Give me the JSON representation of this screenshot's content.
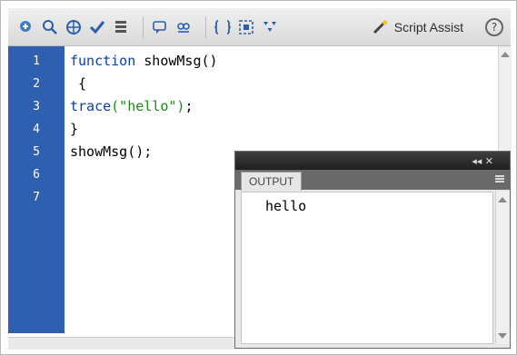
{
  "toolbar": {
    "icons": [
      "add-statement-icon",
      "find-icon",
      "target-path-icon",
      "check-syntax-icon",
      "auto-format-icon",
      "code-hint-icon",
      "debug-options-icon",
      "collapse-between-braces-icon",
      "collapse-selection-icon",
      "expand-all-icon"
    ],
    "script_assist_label": "Script Assist",
    "help_label": "?"
  },
  "editor": {
    "line_numbers": [
      "1",
      "2",
      "3",
      "4",
      "5",
      "6",
      "7"
    ],
    "lines": [
      {
        "kw": "function",
        "rest": " showMsg()"
      },
      {
        "text": " {"
      },
      {
        "kw": "trace",
        "str": "(\"hello\")",
        "rest": ";"
      },
      {
        "text": "}"
      },
      {
        "text": "showMsg();"
      }
    ],
    "colors": {
      "gutter": "#2f5faf",
      "keyword": "#0b3ea8",
      "string": "#1b8a17"
    }
  },
  "output_panel": {
    "tab_label": "OUTPUT",
    "title_controls": "◂◂ ✕",
    "content": "hello"
  }
}
